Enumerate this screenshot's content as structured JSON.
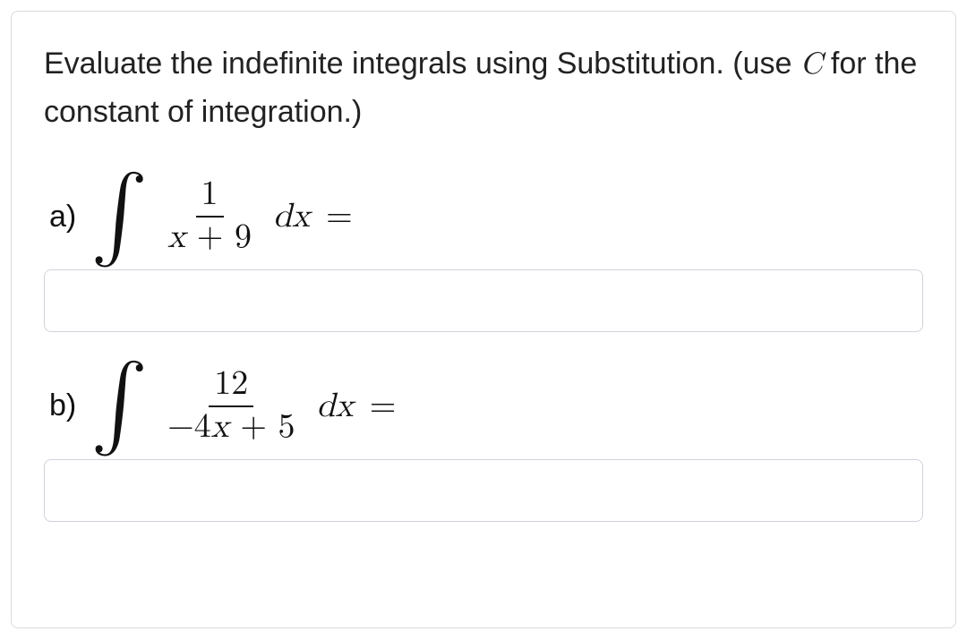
{
  "prompt": {
    "part1": "Evaluate the indefinite integrals using Substitution. (use ",
    "constant_symbol": "C",
    "part2": " for the constant of integration.)"
  },
  "problems": [
    {
      "label": "a)",
      "integrand_numerator": "1",
      "integrand_denominator": "x + 9",
      "differential": "dx",
      "equals": "=",
      "answer_value": ""
    },
    {
      "label": "b)",
      "integrand_numerator": "12",
      "integrand_denominator": "−4x + 5",
      "differential": "dx",
      "equals": "=",
      "answer_value": ""
    }
  ]
}
